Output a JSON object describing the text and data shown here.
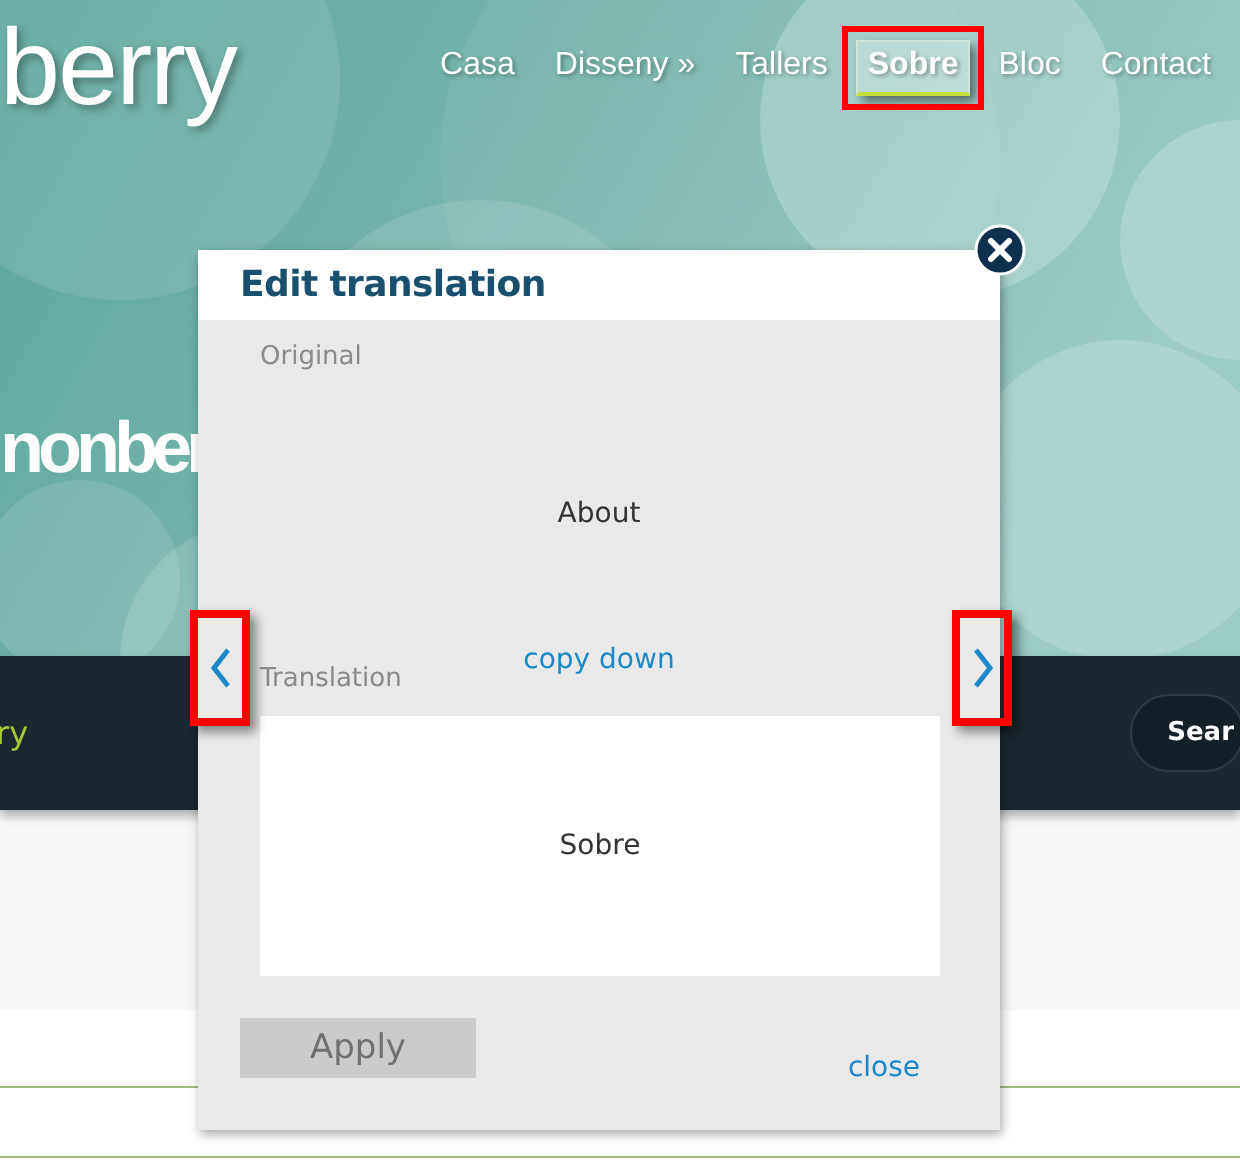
{
  "site": {
    "logo": "berry",
    "nav": [
      {
        "label": "Casa",
        "selected": false,
        "highlighted": false
      },
      {
        "label": "Disseny »",
        "selected": false,
        "highlighted": false
      },
      {
        "label": "Tallers",
        "selected": false,
        "highlighted": false
      },
      {
        "label": "Sobre",
        "selected": true,
        "highlighted": true
      },
      {
        "label": "Bloc",
        "selected": false,
        "highlighted": false
      },
      {
        "label": "Contact",
        "selected": false,
        "highlighted": false
      }
    ],
    "hero_title": "nonber",
    "bar_text": "ry",
    "search_button": "Sear"
  },
  "dialog": {
    "title": "Edit translation",
    "original_label": "Original",
    "original_text": "About",
    "copy_down": "copy down",
    "translation_label": "Translation",
    "translation_value": "Sobre",
    "prev": {
      "highlighted": true
    },
    "next": {
      "highlighted": true
    },
    "apply": {
      "label": "Apply",
      "disabled": true
    },
    "close_link": "close"
  }
}
